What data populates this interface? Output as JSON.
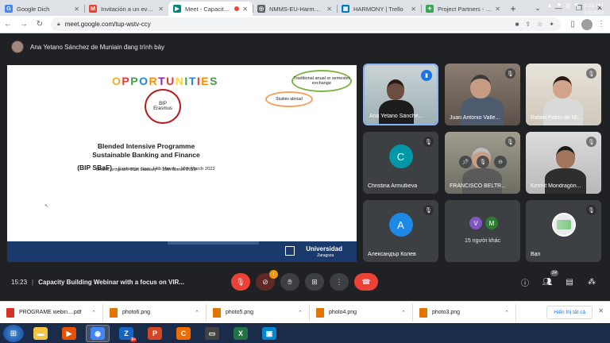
{
  "browser": {
    "tabs": [
      {
        "label": "Google Dich",
        "favicon": "google-translate-icon",
        "color": "#4285f4",
        "glyph": "G",
        "active": false
      },
      {
        "label": "Invitación a un evento: Ca",
        "favicon": "gmail-icon",
        "color": "#ea4335",
        "glyph": "M",
        "active": false
      },
      {
        "label": "Meet - Capacity Bu",
        "favicon": "google-meet-icon",
        "color": "#00897b",
        "glyph": "▶",
        "active": true,
        "recording": true
      },
      {
        "label": "NMMS-EU-Harmony-I",
        "favicon": "chrome-icon",
        "color": "#5f6368",
        "glyph": "◎",
        "active": false
      },
      {
        "label": "HARMONY | Trello",
        "favicon": "trello-icon",
        "color": "#0079bf",
        "glyph": "▦",
        "active": false
      },
      {
        "label": "Project Partners - Harm",
        "favicon": "puzzle-icon",
        "color": "#34a853",
        "glyph": "✦",
        "active": false
      }
    ],
    "url": "meet.google.com/tup-wstv-ccy"
  },
  "meet": {
    "presenting_text": "Ana Yetano Sánchez de Muniain đang trình bày",
    "time": "15:23",
    "meeting_title": "Capacity Building Webinar with a focus on VIR...",
    "chat_badge": "!",
    "participant_count": "24",
    "tiles": [
      {
        "name": "Ana Yetano Sánche...",
        "type": "video",
        "speaking": true
      },
      {
        "name": "Juan Antonio Valle...",
        "type": "video",
        "speaking": false
      },
      {
        "name": "Rafael Pablo de Mi...",
        "type": "video",
        "speaking": false
      },
      {
        "name": "Christina Armutlieva",
        "type": "avatar",
        "initial": "C",
        "color": "#0097a7"
      },
      {
        "name": "FRANCISCO BELTR...",
        "type": "video",
        "speaking": false
      },
      {
        "name": "Kermit Mondragón...",
        "type": "video",
        "speaking": false
      },
      {
        "name": "Александър Колев",
        "type": "avatar",
        "initial": "A",
        "color": "#1e88e5"
      },
      {
        "name": "15 người khác",
        "type": "others",
        "avatars": [
          {
            "initial": "V",
            "color": "#7e57c2"
          },
          {
            "initial": "M",
            "color": "#2e7d32"
          }
        ]
      },
      {
        "name": "Bạn",
        "type": "self"
      }
    ]
  },
  "slide": {
    "title_letters": [
      "O",
      "P",
      "P",
      "O",
      "R",
      "T",
      "U",
      "N",
      "I",
      "T",
      "I",
      "E",
      "S"
    ],
    "title_colors": [
      "#f9a825",
      "#e53935",
      "#43a047",
      "#1e88e5",
      "#fb8c00",
      "#8e24aa",
      "#e53935",
      "#fdd835",
      "#43a047",
      "#1e88e5",
      "#e53935",
      "#fb8c00",
      "#43a047"
    ],
    "bip_oval": "BIP\nErasmus",
    "trad_oval": "Traditional anual or semester exchange",
    "abroad_oval": "Studies abroad",
    "heading1": "Blended Intensive Programme",
    "heading2": "Sustainable Banking and Finance",
    "heading3": "(BIP SBaF)",
    "exchange_days": "- Exchange days: 14th  March – 18th March 2022",
    "online_program": "Online program: 31st January – 13th March 2022",
    "university": "Universidad",
    "university_city": "Zaragoza"
  },
  "downloads": [
    {
      "name": "PROGRAME webin....pdf",
      "type": "pdf",
      "color": "#d93025"
    },
    {
      "name": "photo6.png",
      "type": "image",
      "color": "#e37400"
    },
    {
      "name": "photo5.png",
      "type": "image",
      "color": "#e37400"
    },
    {
      "name": "photo4.png",
      "type": "image",
      "color": "#e37400"
    },
    {
      "name": "photo3.png",
      "type": "image",
      "color": "#e37400"
    }
  ],
  "downloads_show_all": "Hiển thị tất cả",
  "taskbar": {
    "apps": [
      {
        "name": "explorer-icon",
        "color": "#f4c542",
        "glyph": "▬"
      },
      {
        "name": "media-player-icon",
        "color": "#e65100",
        "glyph": "▶"
      },
      {
        "name": "chrome-icon",
        "color": "#4285f4",
        "glyph": "◉",
        "active": true
      },
      {
        "name": "zalo-icon",
        "color": "#1565c0",
        "glyph": "Z",
        "badge": "9+"
      },
      {
        "name": "powerpoint-icon",
        "color": "#d24726",
        "glyph": "P"
      },
      {
        "name": "ccleaner-icon",
        "color": "#ef6c00",
        "glyph": "C"
      },
      {
        "name": "terminal-icon",
        "color": "#424242",
        "glyph": "▭"
      },
      {
        "name": "excel-icon",
        "color": "#217346",
        "glyph": "X"
      },
      {
        "name": "remote-desktop-icon",
        "color": "#0288d1",
        "glyph": "▣"
      }
    ],
    "time": "3:23 PM",
    "date": "1/4/2022"
  }
}
